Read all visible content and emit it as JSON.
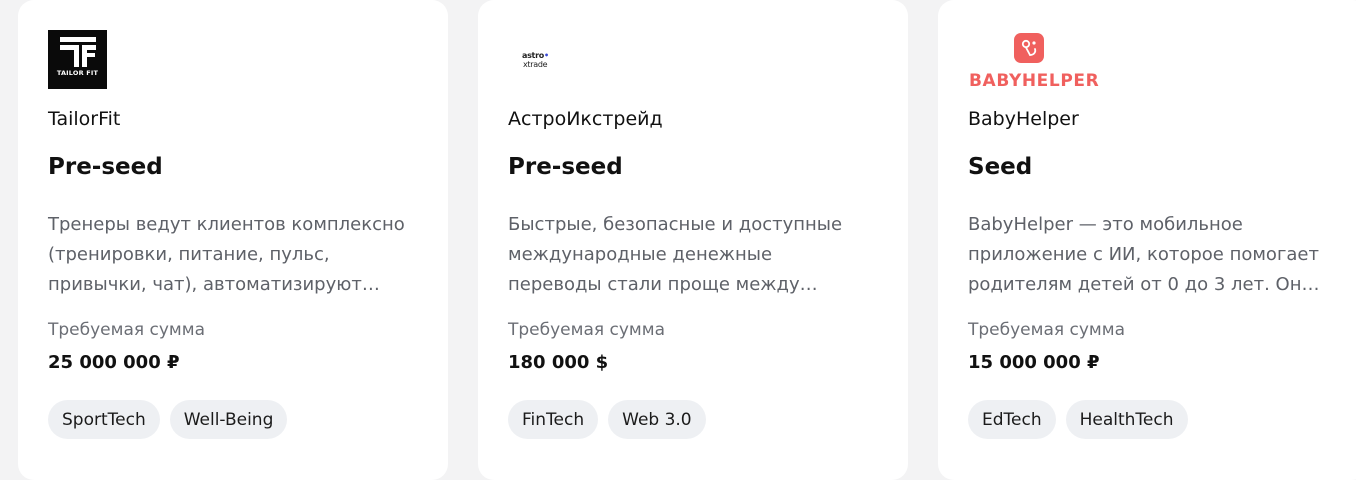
{
  "cards": [
    {
      "logo_text": "TAILOR FIT",
      "name": "TailorFit",
      "stage": "Pre-seed",
      "description": "Тренеры ведут клиентов комплексно\n(тренировки, питание, пульс,\nпривычки, чат), автоматизируют…",
      "amount_label": "Требуемая сумма",
      "amount": "25 000 000 ₽",
      "tags": [
        "SportTech",
        "Well-Being"
      ]
    },
    {
      "logo_text_1": "astro",
      "logo_text_2": "xtrade",
      "name": "АстроИкстрейд",
      "stage": "Pre-seed",
      "description": "Быстрые, безопасные и доступные\nмеждународные денежные\nпереводы стали проще между…",
      "amount_label": "Требуемая сумма",
      "amount": "180 000 $",
      "tags": [
        "FinTech",
        "Web 3.0"
      ]
    },
    {
      "logo_text": "BABYHELPER",
      "name": "BabyHelper",
      "stage": "Seed",
      "description": "BabyHelper — это мобильное\nприложение с ИИ, которое помогает\nродителям детей от 0 до 3 лет. Он…",
      "amount_label": "Требуемая сумма",
      "amount": "15 000 000 ₽",
      "tags": [
        "EdTech",
        "HealthTech"
      ]
    }
  ],
  "colors": {
    "background": "#f3f3f4",
    "card": "#ffffff",
    "tag_bg": "#eef0f3",
    "babyhelper_brand": "#f0605e",
    "astro_accent": "#3a4ad6"
  },
  "icons": [
    "tailorfit-logo-icon",
    "astroxtrade-logo-icon",
    "babyhelper-logo-icon"
  ]
}
